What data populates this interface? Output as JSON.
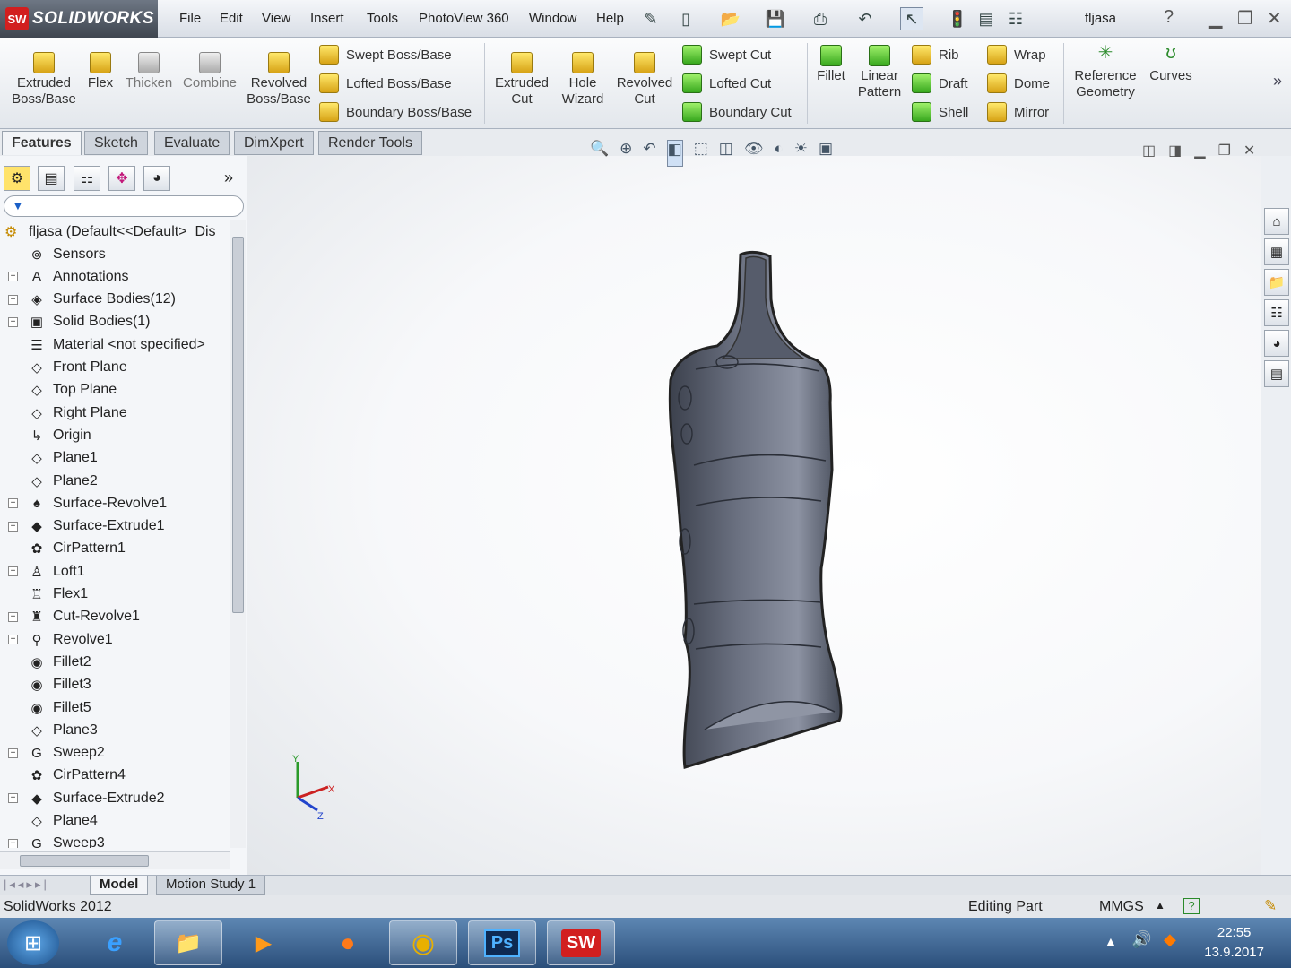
{
  "app": {
    "name": "SOLIDWORKS",
    "doc_title": "fljasa"
  },
  "menu": [
    "File",
    "Edit",
    "View",
    "Insert",
    "Tools",
    "PhotoView 360",
    "Window",
    "Help"
  ],
  "ribbon": {
    "extruded_boss": "Extruded Boss/Base",
    "flex": "Flex",
    "thicken": "Thicken",
    "combine": "Combine",
    "revolved_boss": "Revolved Boss/Base",
    "swept_boss": "Swept Boss/Base",
    "lofted_boss": "Lofted Boss/Base",
    "boundary_boss": "Boundary Boss/Base",
    "extruded_cut": "Extruded Cut",
    "hole_wizard": "Hole Wizard",
    "revolved_cut": "Revolved Cut",
    "swept_cut": "Swept Cut",
    "lofted_cut": "Lofted Cut",
    "boundary_cut": "Boundary Cut",
    "fillet": "Fillet",
    "linear_pattern": "Linear Pattern",
    "rib": "Rib",
    "draft": "Draft",
    "shell": "Shell",
    "wrap": "Wrap",
    "dome": "Dome",
    "mirror": "Mirror",
    "reference_geometry": "Reference Geometry",
    "curves": "Curves"
  },
  "tabs": [
    "Features",
    "Sketch",
    "Evaluate",
    "DimXpert",
    "Render Tools"
  ],
  "tree": {
    "root": "fljasa  (Default<<Default>_Dis",
    "items": [
      {
        "label": "Sensors",
        "exp": false,
        "icon": "sensors-icon",
        "glyph": "⊚"
      },
      {
        "label": "Annotations",
        "exp": true,
        "icon": "annotations-icon",
        "glyph": "A"
      },
      {
        "label": "Surface Bodies(12)",
        "exp": true,
        "icon": "surface-bodies-icon",
        "glyph": "◈"
      },
      {
        "label": "Solid Bodies(1)",
        "exp": true,
        "icon": "solid-bodies-icon",
        "glyph": "▣"
      },
      {
        "label": "Material <not specified>",
        "exp": false,
        "icon": "material-icon",
        "glyph": "☰"
      },
      {
        "label": "Front Plane",
        "exp": false,
        "icon": "plane-icon",
        "glyph": "◇"
      },
      {
        "label": "Top Plane",
        "exp": false,
        "icon": "plane-icon",
        "glyph": "◇"
      },
      {
        "label": "Right Plane",
        "exp": false,
        "icon": "plane-icon",
        "glyph": "◇"
      },
      {
        "label": "Origin",
        "exp": false,
        "icon": "origin-icon",
        "glyph": "↳"
      },
      {
        "label": "Plane1",
        "exp": false,
        "icon": "plane-icon",
        "glyph": "◇"
      },
      {
        "label": "Plane2",
        "exp": false,
        "icon": "plane-icon",
        "glyph": "◇"
      },
      {
        "label": "Surface-Revolve1",
        "exp": true,
        "icon": "surface-revolve-icon",
        "glyph": "♠"
      },
      {
        "label": "Surface-Extrude1",
        "exp": true,
        "icon": "surface-extrude-icon",
        "glyph": "◆"
      },
      {
        "label": "CirPattern1",
        "exp": false,
        "icon": "circular-pattern-icon",
        "glyph": "✿"
      },
      {
        "label": "Loft1",
        "exp": true,
        "icon": "loft-icon",
        "glyph": "♙"
      },
      {
        "label": "Flex1",
        "exp": false,
        "icon": "flex-icon",
        "glyph": "♖"
      },
      {
        "label": "Cut-Revolve1",
        "exp": true,
        "icon": "cut-revolve-icon",
        "glyph": "♜"
      },
      {
        "label": "Revolve1",
        "exp": true,
        "icon": "revolve-icon",
        "glyph": "⚲"
      },
      {
        "label": "Fillet2",
        "exp": false,
        "icon": "fillet-icon",
        "glyph": "◉"
      },
      {
        "label": "Fillet3",
        "exp": false,
        "icon": "fillet-icon",
        "glyph": "◉"
      },
      {
        "label": "Fillet5",
        "exp": false,
        "icon": "fillet-icon",
        "glyph": "◉"
      },
      {
        "label": "Plane3",
        "exp": false,
        "icon": "plane-icon",
        "glyph": "◇"
      },
      {
        "label": "Sweep2",
        "exp": true,
        "icon": "sweep-icon",
        "glyph": "G"
      },
      {
        "label": "CirPattern4",
        "exp": false,
        "icon": "circular-pattern-icon",
        "glyph": "✿"
      },
      {
        "label": "Surface-Extrude2",
        "exp": true,
        "icon": "surface-extrude-icon",
        "glyph": "◆"
      },
      {
        "label": "Plane4",
        "exp": false,
        "icon": "plane-icon",
        "glyph": "◇"
      },
      {
        "label": "Sweep3",
        "exp": true,
        "icon": "sweep-icon",
        "glyph": "G"
      }
    ]
  },
  "bottom_tabs": [
    "Model",
    "Motion Study 1"
  ],
  "status": {
    "version": "SolidWorks 2012",
    "mode": "Editing Part",
    "units": "MMGS"
  },
  "triad": {
    "x": "X",
    "y": "Y",
    "z": "Z"
  },
  "clock": {
    "time": "22:55",
    "date": "13.9.2017"
  },
  "colors": {
    "accent": "#d21f1f",
    "model": "#5a6070",
    "ribbon_bg": "#eef1f5"
  }
}
